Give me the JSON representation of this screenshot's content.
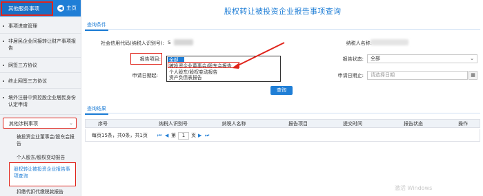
{
  "sidebar": {
    "title": "其他服务事项",
    "home_label": "主页",
    "items": [
      {
        "label": "事项进度管理"
      },
      {
        "label": "非居民企业间接转让财产事项报告"
      },
      {
        "label": "网签三方协议"
      },
      {
        "label": "终止网签三方协议"
      },
      {
        "label": "境外注册中资控股企业居民身份认定申请"
      }
    ],
    "expanded_item": {
      "label": "其他涉税事项"
    },
    "subitems": [
      {
        "label": "被投资企业董事会/股东会报告"
      },
      {
        "label": "个人股东/股权变动报告"
      },
      {
        "label": "股权转让被投资企业报告事项查询"
      },
      {
        "label": "扣缴代扣代缴税款报告"
      }
    ]
  },
  "main": {
    "title": "股权转让被投资企业报告事项查询",
    "query_tab": "查询条件",
    "form": {
      "credit_code_label": "社会信用代码(纳税人识别号):",
      "credit_code_visible_prefix": "S",
      "taxpayer_name_label": "纳税人名称:",
      "report_item_label": "报告项目:",
      "report_item_value": "全部",
      "report_status_label": "报告状态:",
      "report_status_value": "全部",
      "apply_start_label": "申请日期起:",
      "apply_end_label": "申请日期止:",
      "apply_end_placeholder": "请选择日期"
    },
    "dropdown_options": [
      "全部",
      "被投资企业董事会/股东会报告",
      "个人股东/股权变动报告",
      "资产负债表报告"
    ],
    "query_button": "查询",
    "result_tab": "查询结果",
    "table": {
      "columns": [
        "序号",
        "纳税人识别号",
        "纳税人名称",
        "报告项目",
        "提交时间",
        "报告状态",
        "操作"
      ]
    },
    "pager": {
      "summary": "每页15条，共0条，共1页",
      "first": "⏮",
      "prev": "◀",
      "page_prefix": "第",
      "page_value": "1",
      "page_suffix": "页",
      "next": "▶",
      "last": "⏭"
    }
  },
  "colors": {
    "accent": "#1f7ed6",
    "highlight": "#e0241b"
  }
}
